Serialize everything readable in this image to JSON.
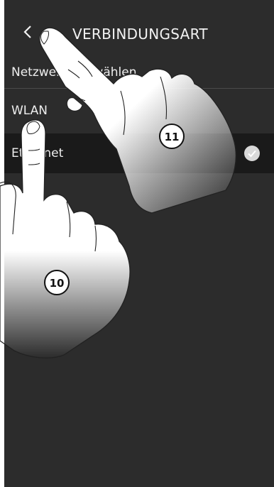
{
  "header": {
    "back_icon": "chevron-left-icon",
    "title": "VERBINDUNGSART"
  },
  "list": {
    "items": [
      {
        "label": "Netzwerk auswählen"
      },
      {
        "label": "WLAN"
      },
      {
        "label": "Ethernet",
        "selected": true,
        "selected_icon": "checkmark-icon"
      }
    ]
  },
  "callouts": {
    "hand_right": "11",
    "hand_left": "10"
  },
  "colors": {
    "screen_background": "#2c2c2c",
    "selected_row_background": "#1a1a1a",
    "text": "#eeeeee",
    "check_badge": "#d9d9d9"
  }
}
